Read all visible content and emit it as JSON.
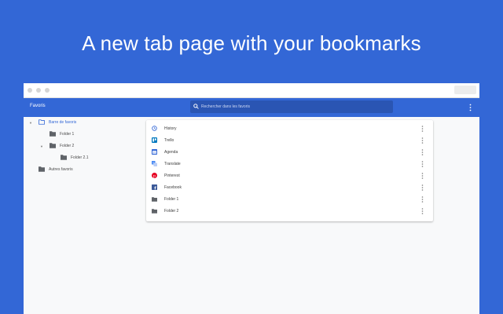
{
  "headline": "A new tab page with your bookmarks",
  "app": {
    "title": "Favoris",
    "search_placeholder": "Rechercher dans les favoris"
  },
  "sidebar": {
    "items": [
      {
        "label": "Barre de favoris",
        "expanded": true,
        "selected": true
      },
      {
        "label": "Folder 1"
      },
      {
        "label": "Folder 2",
        "expanded": true
      },
      {
        "label": "Folder 2.1"
      },
      {
        "label": "Autres favoris"
      }
    ]
  },
  "bookmarks": [
    {
      "label": "History",
      "icon": "history-icon"
    },
    {
      "label": "Trello",
      "icon": "trello-icon"
    },
    {
      "label": "Agenda",
      "icon": "calendar-icon"
    },
    {
      "label": "Translate",
      "icon": "translate-icon"
    },
    {
      "label": "Pinterest",
      "icon": "pinterest-icon"
    },
    {
      "label": "Facebook",
      "icon": "facebook-icon"
    },
    {
      "label": "Folder 1",
      "icon": "folder-icon"
    },
    {
      "label": "Folder 2",
      "icon": "folder-icon"
    }
  ],
  "colors": {
    "accent": "#3367d6",
    "trello": "#0079bf",
    "pinterest": "#e60023",
    "facebook": "#3b5998"
  }
}
